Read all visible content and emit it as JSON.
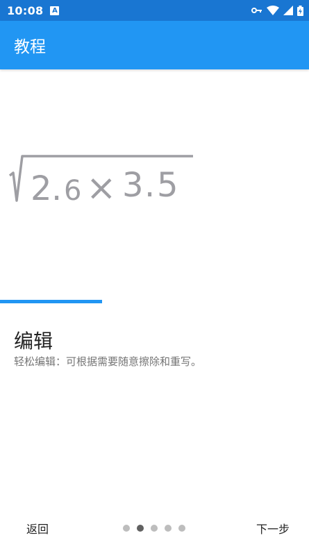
{
  "status_bar": {
    "time": "10:08",
    "notification_badge": "A",
    "icons": [
      "key-icon",
      "wifi-icon",
      "signal-icon",
      "battery-charging-icon"
    ]
  },
  "app_bar": {
    "title": "教程"
  },
  "tutorial": {
    "math_expression": {
      "radical": "√",
      "a": "2",
      "dot1": ".",
      "b": "6",
      "times": "×",
      "c": "3",
      "dot2": ".",
      "d": "5"
    },
    "progress": 0.33,
    "title": "编辑",
    "description": "轻松编辑：可根据需要随意擦除和重写。"
  },
  "navigation": {
    "back_label": "返回",
    "next_label": "下一步",
    "page_count": 5,
    "active_page": 2
  },
  "colors": {
    "status_bar": "#1976d2",
    "app_bar": "#2196f3",
    "accent": "#2196f3",
    "dot_inactive": "#bdbdbd",
    "dot_active": "#616161"
  }
}
